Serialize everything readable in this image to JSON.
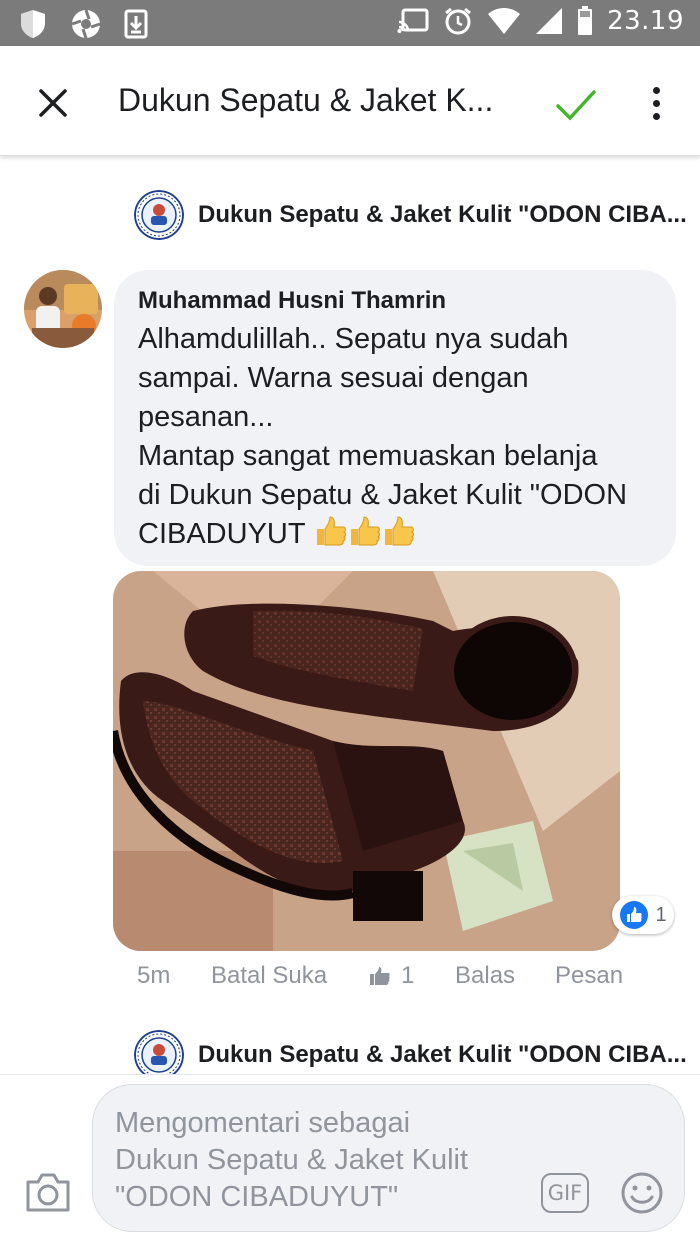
{
  "status_bar": {
    "time": "23.19",
    "left_icons": [
      "shield-icon",
      "aperture-icon",
      "download-icon"
    ],
    "right_icons": [
      "cast-icon",
      "alarm-icon",
      "wifi-icon",
      "signal-icon",
      "battery-icon"
    ]
  },
  "app_bar": {
    "title": "Dukun Sepatu & Jaket K...",
    "check_color": "#42b72a"
  },
  "page_rows": [
    {
      "name": "Dukun Sepatu & Jaket Kulit \"ODON CIBA..."
    },
    {
      "name": "Dukun Sepatu & Jaket Kulit \"ODON CIBA..."
    }
  ],
  "comment": {
    "author": "Muhammad Husni Thamrin",
    "lines": [
      "Alhamdulillah.. Sepatu nya sudah",
      "sampai. Warna sesuai dengan",
      "pesanan...",
      "Mantap sangat memuaskan belanja",
      "di Dukun Sepatu & Jaket Kulit \"ODON",
      "CIBADUYUT"
    ],
    "reaction_count": "1",
    "actions": {
      "time": "5m",
      "unlike": "Batal Suka",
      "like_count": "1",
      "reply": "Balas",
      "message": "Pesan"
    }
  },
  "composer": {
    "placeholder_lines": [
      "Mengomentari sebagai",
      "Dukun Sepatu & Jaket Kulit",
      "\"ODON CIBADUYUT\""
    ],
    "gif_label": "GIF"
  },
  "colors": {
    "facebook_blue": "#1877f2",
    "bubble_bg": "#f0f2f5",
    "muted_text": "#90949c"
  }
}
